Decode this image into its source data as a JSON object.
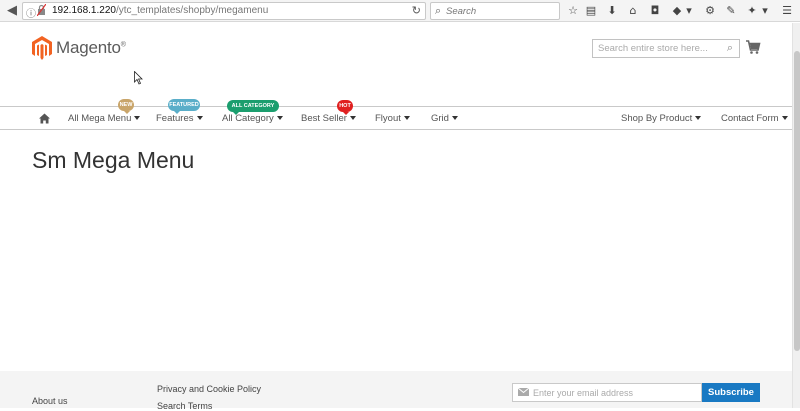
{
  "browser": {
    "url_host": "192.168.1.220",
    "url_path": "/ytc_templates/shopby/megamenu",
    "search_placeholder": "Search"
  },
  "header": {
    "logo_text": "Magento",
    "logo_reg": "®",
    "search_placeholder": "Search entire store here..."
  },
  "nav": {
    "items": [
      {
        "label": "All Mega Menu"
      },
      {
        "label": "Features"
      },
      {
        "label": "All Category"
      },
      {
        "label": "Best Seller"
      },
      {
        "label": "Flyout"
      },
      {
        "label": "Grid"
      },
      {
        "label": "Shop By Product"
      },
      {
        "label": "Contact Form"
      }
    ],
    "badges": [
      {
        "label": "NEW",
        "color": "#c9a56a"
      },
      {
        "label": "FEATURED",
        "color": "#5aaec9"
      },
      {
        "label": "ALL CATEGORY",
        "color": "#1b9e6e"
      },
      {
        "label": "HOT",
        "color": "#e02020"
      }
    ]
  },
  "main": {
    "title": "Sm Mega Menu"
  },
  "footer": {
    "links": [
      "About us",
      "Privacy and Cookie Policy",
      "Search Terms"
    ],
    "newsletter_placeholder": "Enter your email address",
    "subscribe_label": "Subscribe"
  },
  "colors": {
    "accent": "#1979c3",
    "logo_orange": "#f26322"
  }
}
